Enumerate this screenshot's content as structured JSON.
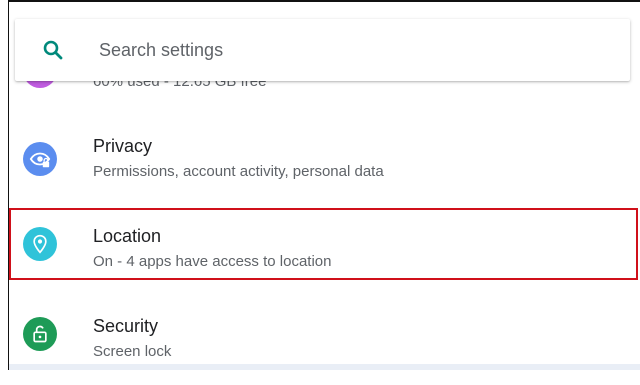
{
  "search": {
    "placeholder": "Search settings",
    "icon": "search-icon"
  },
  "settings": {
    "items": [
      {
        "title": "",
        "subtitle": "60% used - 12.65 GB free",
        "icon": "storage-icon",
        "color": "#c05ce0"
      },
      {
        "title": "Privacy",
        "subtitle": "Permissions, account activity, personal data",
        "icon": "eye-lock-icon",
        "color": "#5b8def"
      },
      {
        "title": "Location",
        "subtitle": "On - 4 apps have access to location",
        "icon": "location-pin-icon",
        "color": "#2fc3d9"
      },
      {
        "title": "Security",
        "subtitle": "Screen lock",
        "icon": "unlocked-padlock-icon",
        "color": "#1e9b57"
      }
    ]
  },
  "colors": {
    "accent": "#00897b",
    "highlight": "#d0101a"
  }
}
